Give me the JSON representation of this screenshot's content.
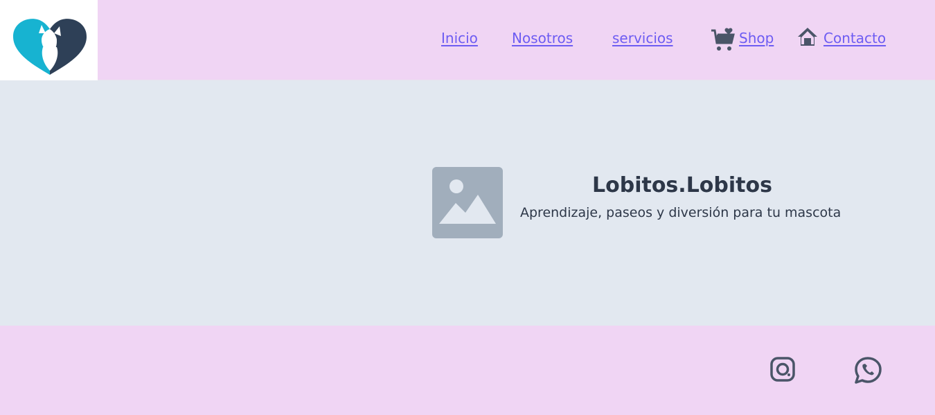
{
  "brand": {
    "logo_icon": "heart-pets-logo-icon",
    "colors": {
      "teal": "#17b3d1",
      "navy": "#2e4057"
    }
  },
  "nav": {
    "items": [
      {
        "label": "Inicio"
      },
      {
        "label": "Nosotros"
      },
      {
        "label": "servicios"
      },
      {
        "label": "Shop",
        "icon": "cart-heart-icon"
      },
      {
        "label": "Contacto",
        "icon": "home-icon"
      }
    ],
    "link_color": "#6d5cf2"
  },
  "hero": {
    "image_icon": "image-placeholder-icon",
    "title": "Lobitos.Lobitos",
    "subtitle": "Aprendizaje, paseos y diversión para tu mascota"
  },
  "footer": {
    "social": [
      {
        "icon": "instagram-icon"
      },
      {
        "icon": "whatsapp-icon"
      }
    ]
  },
  "colors": {
    "header_bg": "#f0d5f4",
    "hero_bg": "#e2e8f0",
    "text_dark": "#2d3748"
  }
}
